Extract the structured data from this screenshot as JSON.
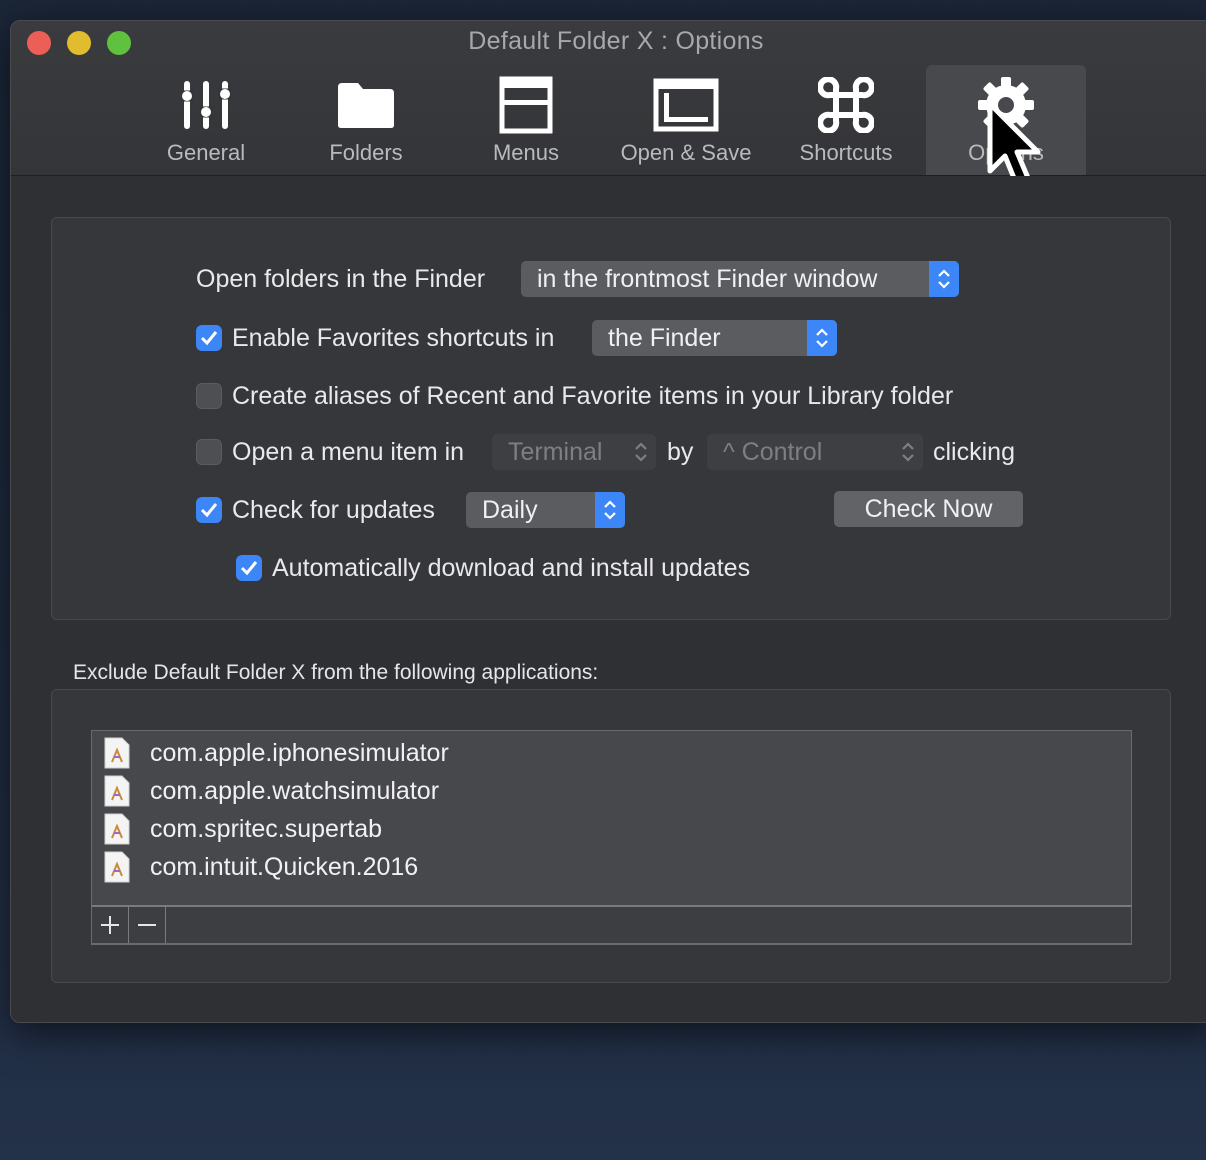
{
  "window": {
    "title": "Default Folder X : Options"
  },
  "toolbar": {
    "tabs": [
      {
        "label": "General",
        "icon": "sliders-icon"
      },
      {
        "label": "Folders",
        "icon": "folder-icon"
      },
      {
        "label": "Menus",
        "icon": "menu-window-icon"
      },
      {
        "label": "Open & Save",
        "icon": "dialog-window-icon"
      },
      {
        "label": "Shortcuts",
        "icon": "command-key-icon"
      },
      {
        "label": "Options",
        "icon": "gear-icon",
        "selected": true
      }
    ]
  },
  "options": {
    "open_folders_label": "Open folders in the Finder",
    "open_folders_value": "in the frontmost Finder window",
    "favorites_label": "Enable Favorites shortcuts in",
    "favorites_checked": true,
    "favorites_value": "the Finder",
    "aliases_label": "Create aliases of Recent and Favorite items in your Library folder",
    "aliases_checked": false,
    "menu_item_label": "Open a menu item in",
    "menu_item_checked": false,
    "menu_item_app": "Terminal",
    "by_label": "by",
    "modifier_value": "^ Control",
    "clicking_label": "clicking",
    "updates_label": "Check for updates",
    "updates_checked": true,
    "updates_value": "Daily",
    "check_now_label": "Check Now",
    "auto_install_label": "Automatically download and install updates",
    "auto_install_checked": true
  },
  "exclude": {
    "heading": "Exclude Default Folder X from the following applications:",
    "items": [
      "com.apple.iphonesimulator",
      "com.apple.watchsimulator",
      "com.spritec.supertab",
      "com.intuit.Quicken.2016"
    ],
    "add_label": "+",
    "remove_label": "—"
  },
  "colors": {
    "accent": "#3d86f7",
    "window_bg": "#2f3034",
    "panel_bg": "#36373b"
  }
}
